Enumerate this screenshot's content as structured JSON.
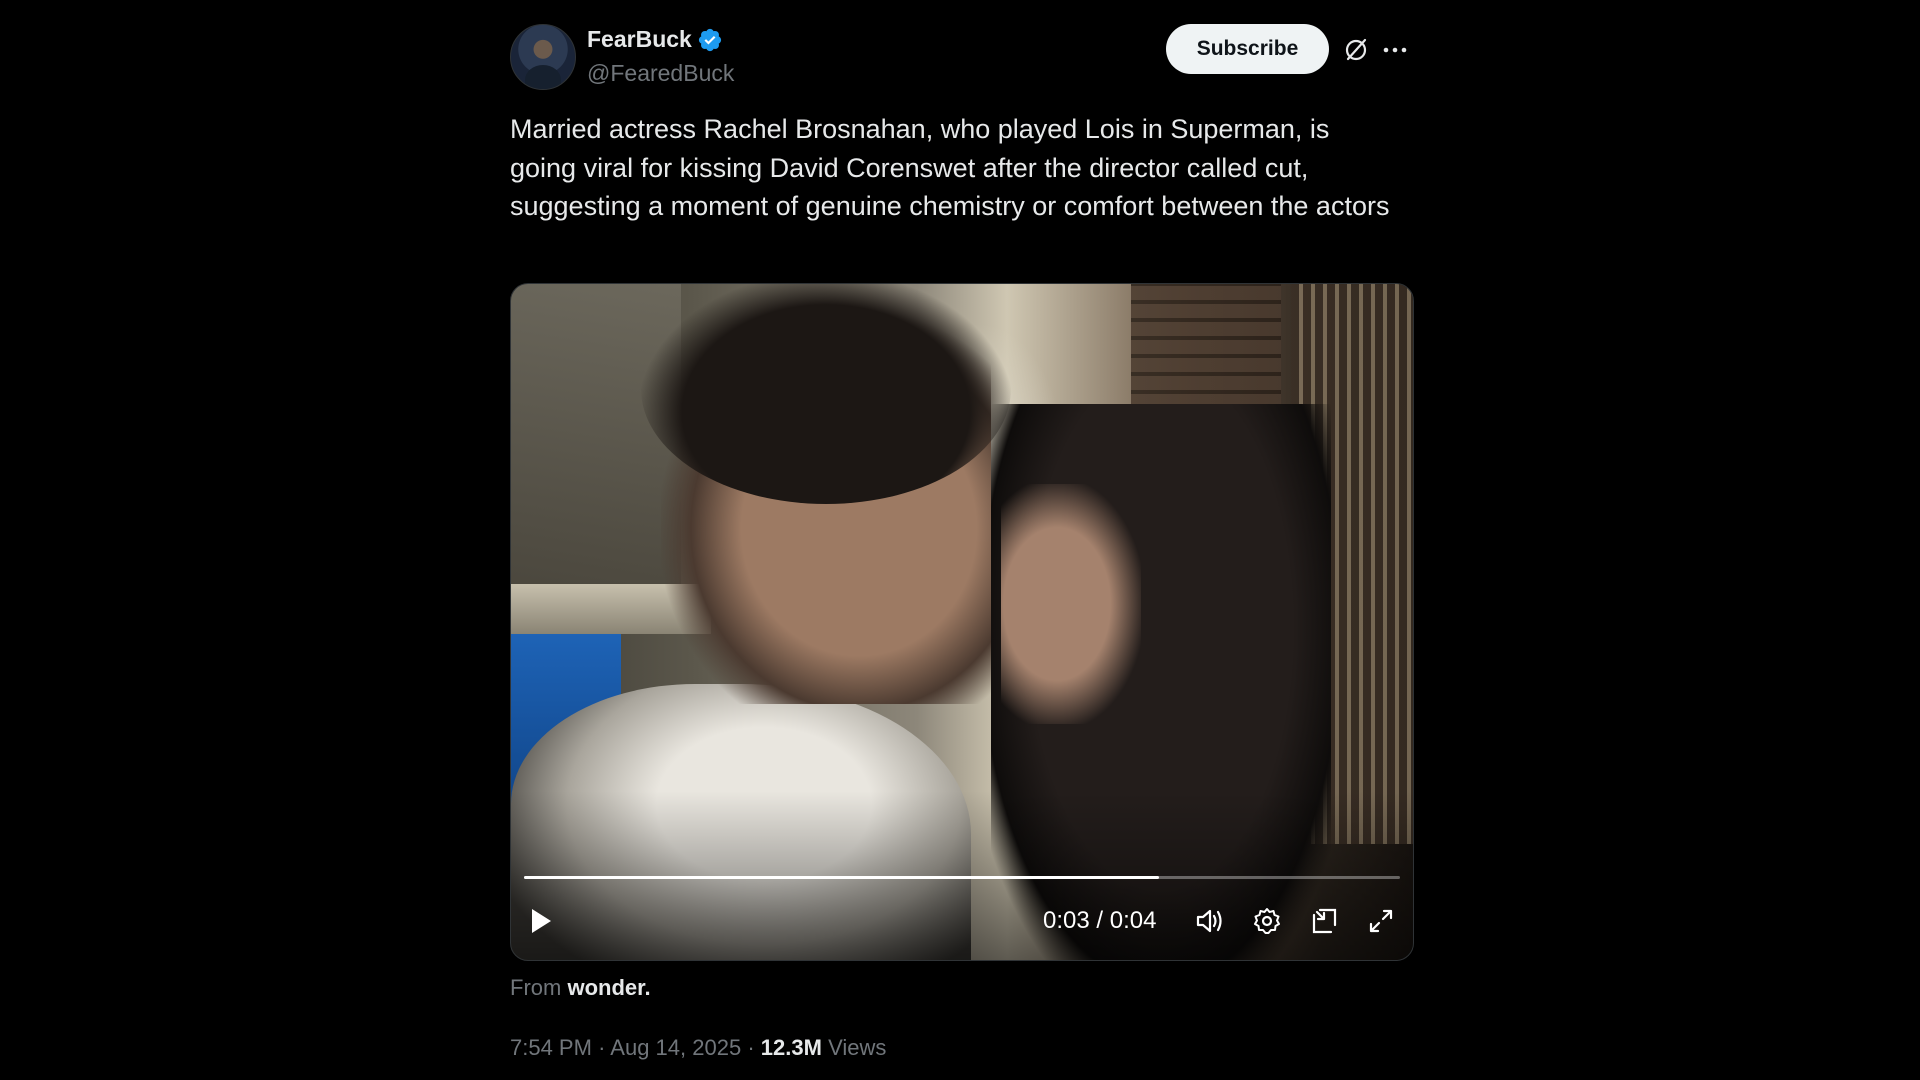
{
  "author": {
    "display_name": "FearBuck",
    "handle": "@FearedBuck",
    "verified": true
  },
  "actions": {
    "subscribe_label": "Subscribe",
    "grok_icon": "grok-icon",
    "more_icon": "more-icon"
  },
  "post": {
    "text": "Married actress Rachel Brosnahan, who played Lois in Superman, is going viral for kissing David Corenswet after the director called cut, suggesting a moment of genuine chemistry or comfort between the actors"
  },
  "video": {
    "current_time": "0:03",
    "duration": "0:04",
    "time_display": "0:03 / 0:04",
    "progress": 0.725,
    "icons": [
      "play-icon",
      "volume-icon",
      "settings-icon",
      "picture-in-picture-icon",
      "fullscreen-icon"
    ]
  },
  "source": {
    "prefix": "From",
    "name": "wonder."
  },
  "meta": {
    "time": "7:54 PM",
    "separator": "·",
    "date": "Aug 14, 2025",
    "views_count": "12.3M",
    "views_label": "Views"
  },
  "colors": {
    "background": "#000000",
    "text_primary": "#e7e9ea",
    "text_secondary": "#71767b",
    "verified_blue": "#1d9bf0",
    "subscribe_bg": "#eff3f4"
  }
}
